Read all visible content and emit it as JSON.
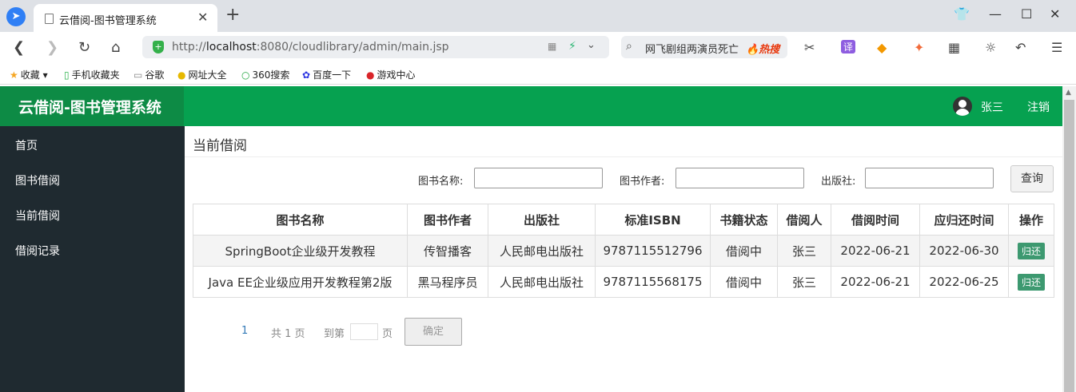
{
  "browser": {
    "tab_title": "云借阅-图书管理系统",
    "url_prefix": "http://",
    "url_host": "localhost",
    "url_rest": ":8080/cloudlibrary/admin/main.jsp",
    "search_text": "网飞剧组两演员死亡",
    "search_hot": "🔥热搜",
    "bookmarks": [
      "收藏",
      "手机收藏夹",
      "谷歌",
      "网址大全",
      "360搜索",
      "百度一下",
      "游戏中心"
    ]
  },
  "app": {
    "logo": "云借阅-图书管理系统",
    "user": "张三",
    "logout": "注销",
    "sidebar": [
      "首页",
      "图书借阅",
      "当前借阅",
      "借阅记录"
    ],
    "page_title": "当前借阅",
    "filters": {
      "name_label": "图书名称:",
      "author_label": "图书作者:",
      "press_label": "出版社:",
      "query_button": "查询"
    },
    "table": {
      "headers": [
        "图书名称",
        "图书作者",
        "出版社",
        "标准ISBN",
        "书籍状态",
        "借阅人",
        "借阅时间",
        "应归还时间",
        "操作"
      ],
      "rows": [
        [
          "SpringBoot企业级开发教程",
          "传智播客",
          "人民邮电出版社",
          "9787115512796",
          "借阅中",
          "张三",
          "2022-06-21",
          "2022-06-30",
          "归还"
        ],
        [
          "Java EE企业级应用开发教程第2版",
          "黑马程序员",
          "人民邮电出版社",
          "9787115568175",
          "借阅中",
          "张三",
          "2022-06-21",
          "2022-06-25",
          "归还"
        ]
      ]
    },
    "pager": {
      "current": "1",
      "total": "共 1 页",
      "goto": "到第",
      "page": "页",
      "confirm": "确定"
    }
  }
}
